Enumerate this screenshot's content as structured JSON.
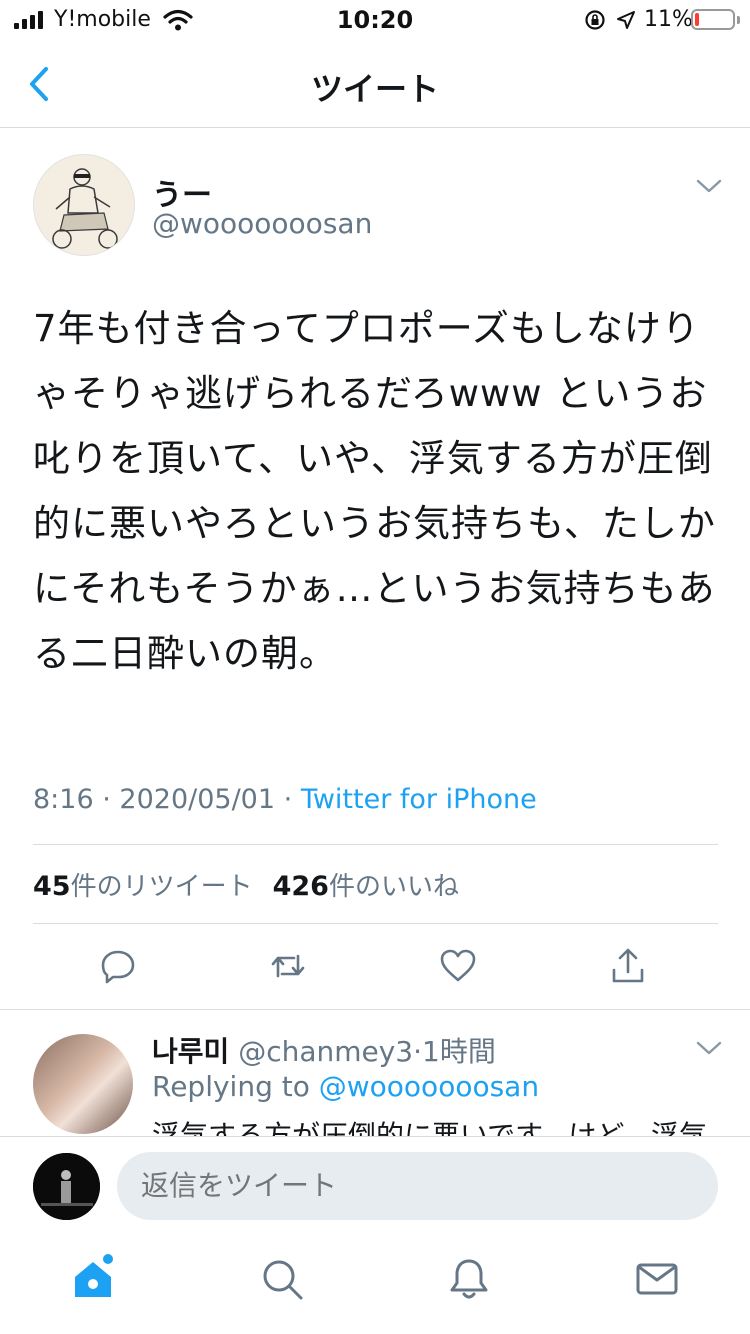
{
  "status_bar": {
    "carrier": "Y!mobile",
    "time": "10:20",
    "battery_percent": "11%",
    "battery_level": 0.11
  },
  "nav": {
    "title": "ツイート"
  },
  "tweet": {
    "author_name": "うー",
    "author_handle": "@wooooooosan",
    "text": "7年も付き合ってプロポーズもしなけりゃそりゃ逃げられるだろwww というお叱りを頂いて、いや、浮気する方が圧倒的に悪いやろというお気持ちも、たしかにそれもそうかぁ…というお気持ちもある二日酔いの朝。",
    "time": "8:16",
    "date": "2020/05/01",
    "separator": "·",
    "source": "Twitter for iPhone",
    "retweets_count": "45",
    "retweets_label": "件のリツイート",
    "likes_count": "426",
    "likes_label": "件のいいね"
  },
  "reply": {
    "name": "나루미",
    "handle": "@chanmey3",
    "separator": "·",
    "age": "1時間",
    "replying_prefix": "Replying to",
    "replying_to": "@wooooooosan",
    "text": "浮気する方が圧倒的に悪いです。けど、浮気"
  },
  "composer": {
    "placeholder": "返信をツイート"
  },
  "colors": {
    "accent": "#1da1f2",
    "secondary_text": "#657786",
    "divider": "#d8dde1"
  }
}
